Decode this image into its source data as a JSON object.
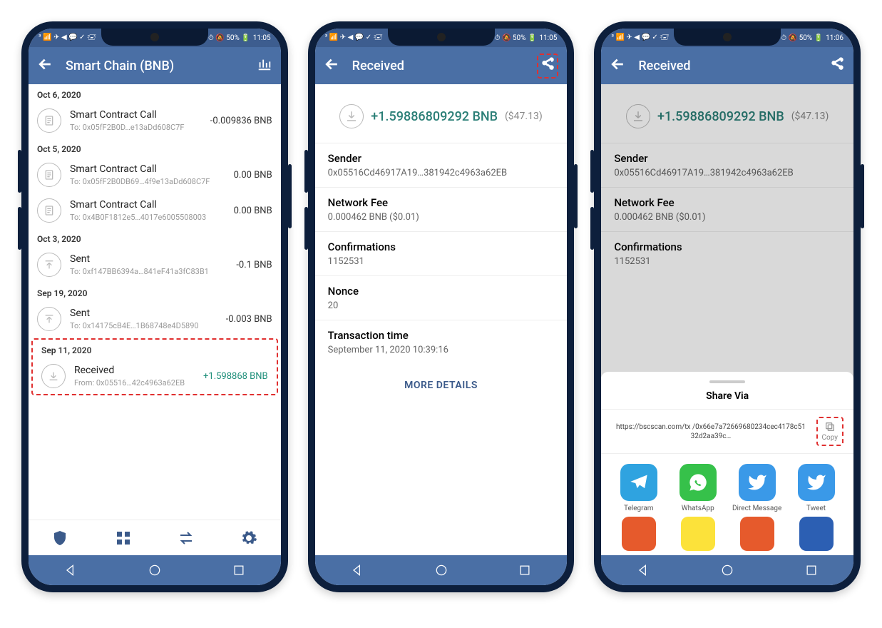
{
  "status": {
    "left": "³ 📶 ✈ ◀ 💬 ✓ 🖅",
    "right_icons": "ℕ ⏱ 🔕 50% 🔋",
    "time1": "11:05",
    "time2": "11:06"
  },
  "screen1": {
    "title": "Smart Chain (BNB)",
    "groups": [
      {
        "date": "Oct 6, 2020",
        "tx": [
          {
            "icon": "contract",
            "title": "Smart Contract Call",
            "sub": "To: 0x05fF2B0D…e13aDd608C7F",
            "amt": "-0.009836 BNB"
          }
        ]
      },
      {
        "date": "Oct 5, 2020",
        "tx": [
          {
            "icon": "contract",
            "title": "Smart Contract Call",
            "sub": "To: 0x05fF2B0DB69…4f9e13aDd608C7F",
            "amt": "0.00 BNB"
          },
          {
            "icon": "contract",
            "title": "Smart Contract Call",
            "sub": "To: 0x4B0F1812e5…4017e6005508003",
            "amt": "0.00 BNB"
          }
        ]
      },
      {
        "date": "Oct 3, 2020",
        "tx": [
          {
            "icon": "sent",
            "title": "Sent",
            "sub": "To: 0xf147BB6394a…841eF41a3fC83B1",
            "amt": "-0.1 BNB"
          }
        ]
      },
      {
        "date": "Sep 19, 2020",
        "tx": [
          {
            "icon": "sent",
            "title": "Sent",
            "sub": "To: 0x14175cB4E…1B68748e4D5890",
            "amt": "-0.003 BNB"
          }
        ]
      },
      {
        "date": "Sep 11, 2020",
        "highlight": true,
        "tx": [
          {
            "icon": "received",
            "title": "Received",
            "sub": "From: 0x05516…42c4963a62EB",
            "amt": "+1.598868 BNB",
            "positive": true
          }
        ]
      }
    ]
  },
  "screen2": {
    "title": "Received",
    "amount": "+1.59886809292 BNB",
    "fiat": "($47.13)",
    "rows": [
      {
        "label": "Sender",
        "value": "0x05516Cd46917A19…381942c4963a62EB"
      },
      {
        "label": "Network Fee",
        "value": "0.000462 BNB ($0.01)"
      },
      {
        "label": "Confirmations",
        "value": "1152531"
      },
      {
        "label": "Nonce",
        "value": "20"
      },
      {
        "label": "Transaction time",
        "value": "September 11, 2020 10:39:16"
      }
    ],
    "more": "MORE DETAILS"
  },
  "screen3": {
    "title": "Received",
    "amount": "+1.59886809292 BNB",
    "fiat": "($47.13)",
    "rows": [
      {
        "label": "Sender",
        "value": "0x05516Cd46917A19…381942c4963a62EB"
      },
      {
        "label": "Network Fee",
        "value": "0.000462 BNB ($0.01)"
      },
      {
        "label": "Confirmations",
        "value": "1152531"
      }
    ],
    "share_title": "Share Via",
    "link": "https://bscscan.com/tx\n/0x66e7a72669680234cec4178c5132d2aa39c…",
    "copy": "Copy",
    "apps": [
      {
        "name": "Telegram",
        "color": "#2fa3e0"
      },
      {
        "name": "WhatsApp",
        "color": "#36c14a"
      },
      {
        "name": "Direct Message",
        "color": "#3a99e8"
      },
      {
        "name": "Tweet",
        "color": "#3a99e8"
      }
    ],
    "apps2_colors": [
      "#e65a2c",
      "#fce23a",
      "#e65a2c",
      "#2c5fb3"
    ]
  }
}
